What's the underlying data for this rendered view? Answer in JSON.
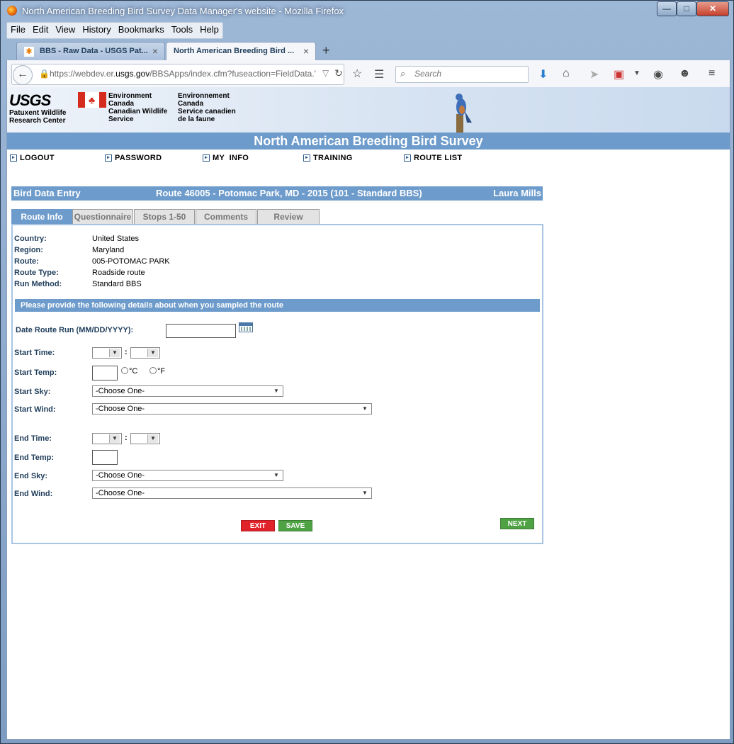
{
  "window": {
    "title": "North American Breeding Bird Survey Data Manager's website - Mozilla Firefox",
    "controls": {
      "minimize": "—",
      "maximize": "□",
      "close": "✕"
    }
  },
  "menu": [
    "File",
    "Edit",
    "View",
    "History",
    "Bookmarks",
    "Tools",
    "Help"
  ],
  "browser_tabs": [
    {
      "label": "BBS - Raw Data - USGS Pat...",
      "active": false
    },
    {
      "label": "North American Breeding Bird ...",
      "active": true
    }
  ],
  "new_tab": "+",
  "url": {
    "prefix": "https://webdev.er.",
    "domain": "usgs.gov",
    "suffix": "/BBSApps/index.cfm?fuseaction=FieldData.'"
  },
  "search_placeholder": "Search",
  "banner": {
    "usgs": "USGS",
    "usgs_sub": [
      "Patuxent Wildlife",
      "Research Center"
    ],
    "ec_en": [
      "Environment",
      "Canada",
      "Canadian Wildlife",
      "Service"
    ],
    "ec_fr": [
      "Environnement",
      "Canada",
      "Service canadien",
      "de la faune"
    ],
    "title": "North American Breeding Bird Survey"
  },
  "nav_links": [
    "LOGOUT",
    "PASSWORD",
    "MY  INFO",
    "TRAINING",
    "ROUTE LIST"
  ],
  "header": {
    "left": "Bird Data Entry",
    "center": "Route 46005 - Potomac Park, MD - 2015 (101 - Standard BBS)",
    "right": "Laura Mills"
  },
  "form_tabs": [
    "Route Info",
    "Questionnaire",
    "Stops 1-50",
    "Comments",
    "Review"
  ],
  "route_info": [
    {
      "label": "Country:",
      "value": "United States"
    },
    {
      "label": "Region:",
      "value": "Maryland"
    },
    {
      "label": "Route:",
      "value": "005-POTOMAC PARK"
    },
    {
      "label": "Route Type:",
      "value": "Roadside route"
    },
    {
      "label": "Run Method:",
      "value": "Standard BBS"
    }
  ],
  "section_title": "Please provide the following details about when you sampled the route",
  "fields": {
    "date_label": "Date Route Run (MM/DD/YYYY):",
    "start_time": "Start Time:",
    "start_temp": "Start Temp:",
    "start_sky": "Start Sky:",
    "start_wind": "Start Wind:",
    "end_time": "End Time:",
    "end_temp": "End Temp:",
    "end_sky": "End Sky:",
    "end_wind": "End Wind:",
    "colon": ":",
    "unit_c": "°C",
    "unit_f": "°F",
    "choose": "-Choose One-"
  },
  "buttons": {
    "exit": "EXIT",
    "save": "SAVE",
    "next": "NEXT"
  }
}
